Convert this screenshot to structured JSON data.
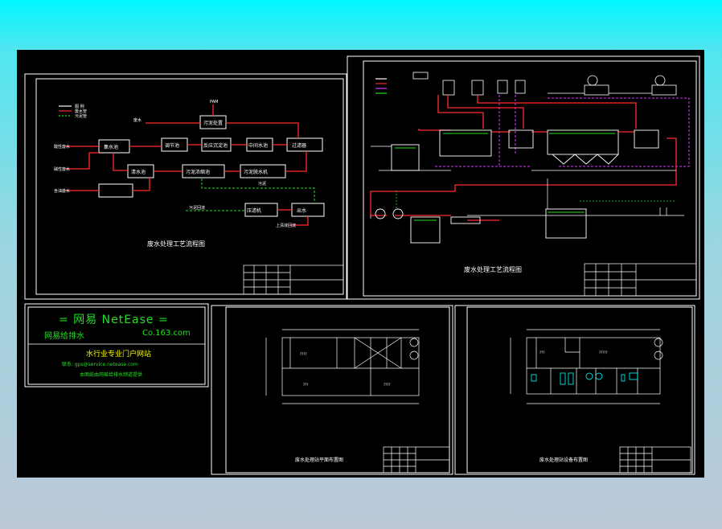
{
  "titles": {
    "flow_left": "废水处理工艺流程图",
    "flow_right": "废水处理工艺流程图",
    "plan_left": "废水处理站平面布置图",
    "plan_right": "废水处理站设备布置图"
  },
  "netease": {
    "line1": "=  网易 NetEase  =",
    "line2_left": "网易给排水",
    "line2_right": "Co.163.com",
    "line3": "水行业专业门户网站",
    "line4": "联系: gps@service.netease.com",
    "line5": "本图纸由网易给排水频道提供"
  },
  "flow_nodes": {
    "n1": "污泥处置",
    "n2": "集水池",
    "n3": "调节池",
    "n4": "反应沉淀池",
    "n5": "中间水池",
    "n6": "过滤器",
    "n7": "清水池",
    "n8": "污泥浓缩池",
    "n9": "污泥脱水机",
    "n10": "压滤机",
    "n11": "出水"
  },
  "colors": {
    "red": "#ff2a2a",
    "green": "#21e021",
    "magenta": "#d23cff",
    "white": "#ffffff",
    "cyan": "#00ffff",
    "yellow": "#ffff00"
  }
}
